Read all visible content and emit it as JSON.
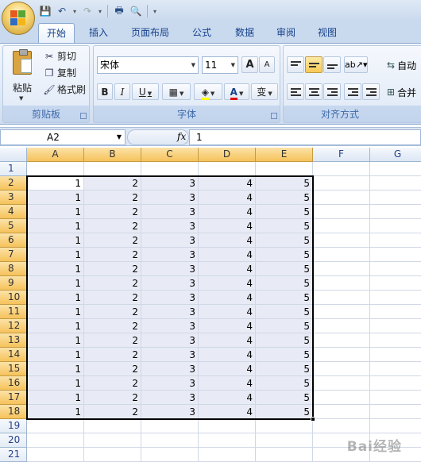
{
  "qat": {
    "icons": [
      "save-icon",
      "undo-icon",
      "redo-icon",
      "print-icon",
      "print-preview-icon",
      "customize-qat-icon"
    ]
  },
  "tabs": [
    "开始",
    "插入",
    "页面布局",
    "公式",
    "数据",
    "审阅",
    "视图"
  ],
  "active_tab": "开始",
  "clipboard": {
    "paste_label": "粘贴",
    "cut_label": "剪切",
    "copy_label": "复制",
    "format_painter_label": "格式刷",
    "group_label": "剪贴板"
  },
  "font": {
    "font_name": "宋体",
    "font_size": "11",
    "grow_label": "A",
    "shrink_label": "A",
    "bold_label": "B",
    "italic_label": "I",
    "underline_label": "U",
    "font_color_label": "A",
    "phonetic_label": "变",
    "group_label": "字体",
    "accent_fill_color": "#ffff00",
    "accent_font_color": "#e01010"
  },
  "alignment": {
    "wrap_label": "自动",
    "merge_label": "合并",
    "group_label": "对齐方式"
  },
  "formula_bar": {
    "name_box": "A2",
    "fx_label": "fx",
    "formula_value": "1"
  },
  "sheet": {
    "columns": [
      "A",
      "B",
      "C",
      "D",
      "E",
      "F",
      "G"
    ],
    "rows": [
      "1",
      "2",
      "3",
      "4",
      "5",
      "6",
      "7",
      "8",
      "9",
      "10",
      "11",
      "12",
      "13",
      "14",
      "15",
      "16",
      "17",
      "18",
      "19",
      "20",
      "21"
    ],
    "selected_columns": [
      "A",
      "B",
      "C",
      "D",
      "E"
    ],
    "selected_rows": [
      "2",
      "3",
      "4",
      "5",
      "6",
      "7",
      "8",
      "9",
      "10",
      "11",
      "12",
      "13",
      "14",
      "15",
      "16",
      "17",
      "18"
    ],
    "selection_range": "A2:E18",
    "data_rows": [
      [
        "1",
        "2",
        "3",
        "4",
        "5"
      ],
      [
        "1",
        "2",
        "3",
        "4",
        "5"
      ],
      [
        "1",
        "2",
        "3",
        "4",
        "5"
      ],
      [
        "1",
        "2",
        "3",
        "4",
        "5"
      ],
      [
        "1",
        "2",
        "3",
        "4",
        "5"
      ],
      [
        "1",
        "2",
        "3",
        "4",
        "5"
      ],
      [
        "1",
        "2",
        "3",
        "4",
        "5"
      ],
      [
        "1",
        "2",
        "3",
        "4",
        "5"
      ],
      [
        "1",
        "2",
        "3",
        "4",
        "5"
      ],
      [
        "1",
        "2",
        "3",
        "4",
        "5"
      ],
      [
        "1",
        "2",
        "3",
        "4",
        "5"
      ],
      [
        "1",
        "2",
        "3",
        "4",
        "5"
      ],
      [
        "1",
        "2",
        "3",
        "4",
        "5"
      ],
      [
        "1",
        "2",
        "3",
        "4",
        "5"
      ],
      [
        "1",
        "2",
        "3",
        "4",
        "5"
      ],
      [
        "1",
        "2",
        "3",
        "4",
        "5"
      ],
      [
        "1",
        "2",
        "3",
        "4",
        "5"
      ]
    ]
  },
  "watermark": "Bai经验"
}
